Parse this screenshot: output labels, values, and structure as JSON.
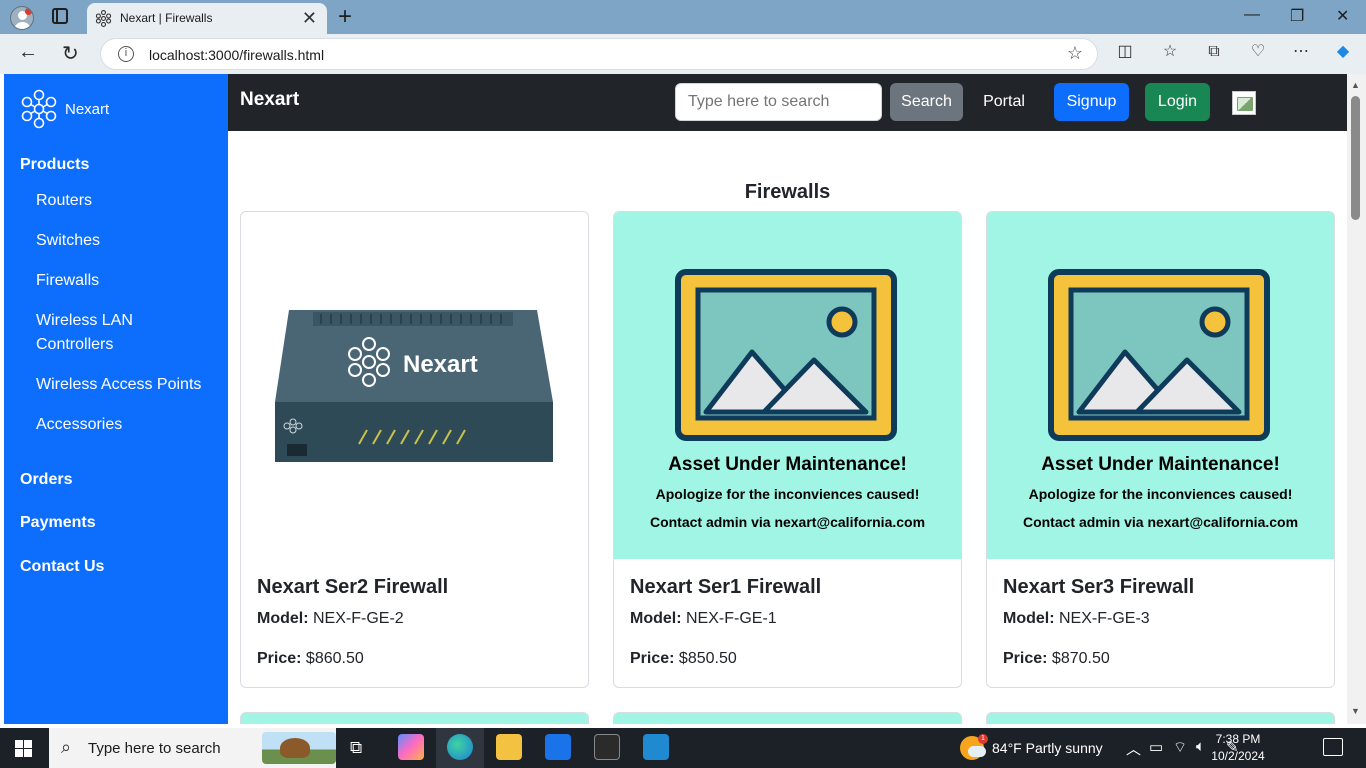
{
  "browser": {
    "tab_title": "Nexart | Firewalls",
    "url": "localhost:3000/firewalls.html"
  },
  "sidebar": {
    "brand": "Nexart",
    "products_label": "Products",
    "product_items": [
      "Routers",
      "Switches",
      "Firewalls",
      "Wireless LAN Controllers",
      "Wireless Access Points",
      "Accessories"
    ],
    "orders_label": "Orders",
    "payments_label": "Payments",
    "contact_label": "Contact Us"
  },
  "navbar": {
    "title": "Nexart",
    "search_placeholder": "Type here to search",
    "search_button": "Search",
    "portal_link": "Portal",
    "signup_button": "Signup",
    "login_button": "Login"
  },
  "page": {
    "heading": "Firewalls"
  },
  "products": [
    {
      "image_kind": "device",
      "device_logo_text": "Nexart",
      "name": "Nexart Ser2 Firewall",
      "model_label": "Model:",
      "model": "NEX-F-GE-2",
      "price_label": "Price:",
      "price": "$860.50"
    },
    {
      "image_kind": "maintenance",
      "maintenance_title": "Asset Under Maintenance!",
      "maintenance_line1": "Apologize for the inconviences caused!",
      "maintenance_line2": "Contact admin via nexart@california.com",
      "name": "Nexart Ser1 Firewall",
      "model_label": "Model:",
      "model": "NEX-F-GE-1",
      "price_label": "Price:",
      "price": "$850.50"
    },
    {
      "image_kind": "maintenance",
      "maintenance_title": "Asset Under Maintenance!",
      "maintenance_line1": "Apologize for the inconviences caused!",
      "maintenance_line2": "Contact admin via nexart@california.com",
      "name": "Nexart Ser3 Firewall",
      "model_label": "Model:",
      "model": "NEX-F-GE-3",
      "price_label": "Price:",
      "price": "$870.50"
    }
  ],
  "taskbar": {
    "search_placeholder": "Type here to search",
    "weather": "84°F  Partly sunny",
    "weather_badge": "1",
    "time": "7:38 PM",
    "date": "10/2/2024"
  },
  "colors": {
    "sidebar": "#0d6efd",
    "navbar": "#212529",
    "search_button": "#6c757d",
    "signup_button": "#0d6efd",
    "login_button": "#198754",
    "maintenance_bg": "#a0f5e4"
  }
}
